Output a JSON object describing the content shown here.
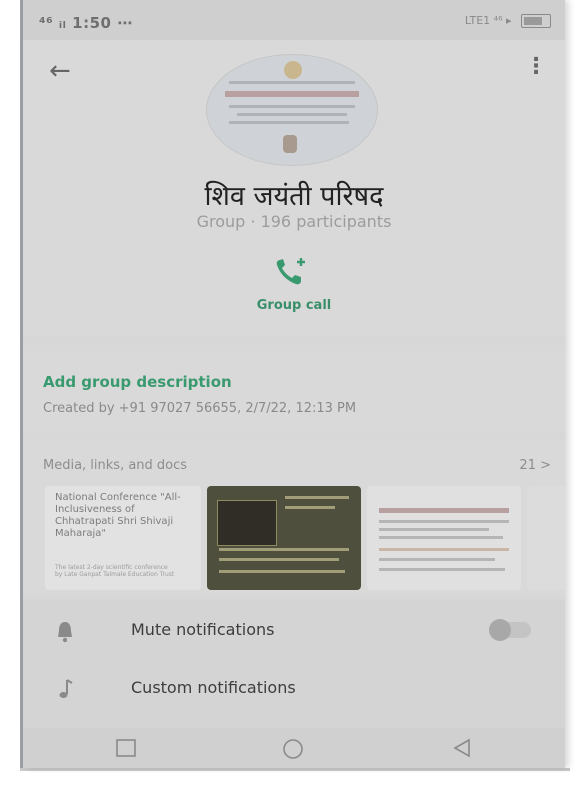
{
  "status": {
    "left": "⁴⁶ ᵢₗ 1:50 ⋯",
    "right": "LTE1 ⁴⁶ ▸"
  },
  "header": {
    "title": "शिव जयंती परिषद",
    "subtitle": "Group · 196 participants",
    "group_call_label": "Group call"
  },
  "description": {
    "add_label": "Add group description",
    "created_by": "Created by +91 97027 56655, 2/7/22, 12:13 PM"
  },
  "media": {
    "label": "Media, links, and docs",
    "count": "21 >",
    "thumb1_text": "National Conference \"All-Inclusiveness of Chhatrapati Shri Shivaji Maharaja\"",
    "thumb1_small": "The latest 2-day scientific conference by Late Ganpat Talmale Education Trust"
  },
  "settings": {
    "mute_label": "Mute notifications",
    "custom_label": "Custom notifications"
  },
  "colors": {
    "accent": "#3a9a6f"
  }
}
